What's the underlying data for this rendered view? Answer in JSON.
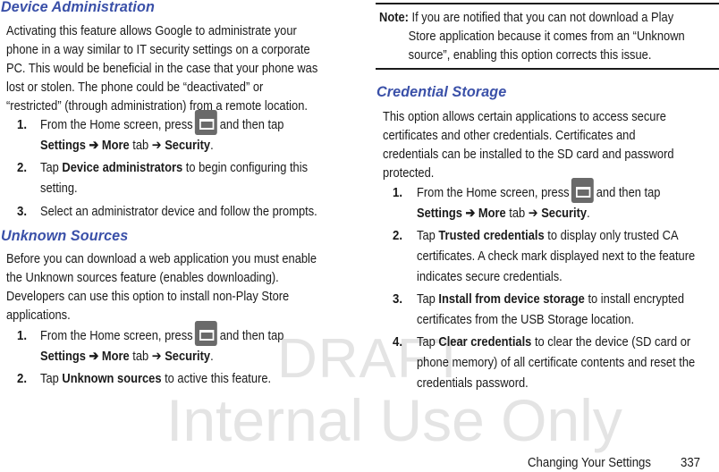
{
  "watermark": {
    "line1": "DRAFT",
    "line2": "Internal Use Only"
  },
  "left_column": {
    "device_admin": {
      "heading": "Device Administration",
      "paragraph_lines": [
        "Activating this feature allows Google to administrate your",
        "phone in a way similar to IT security settings on a corporate",
        "PC. This would be beneficial in the case that your phone was",
        "lost or stolen. The phone could be “deactivated” or",
        "“restricted” (through administration) from a remote location."
      ],
      "steps": [
        {
          "num": "1.",
          "pre": "From the Home screen, press",
          "icon": "menu-key-icon",
          "post": "and then tap",
          "line2_bold1": "Settings ➔ More",
          "line2_mid": " tab ➔ ",
          "line2_bold2": "Security",
          "line2_end": "."
        },
        {
          "num": "2.",
          "pre": "Tap ",
          "bold": "Device administrators",
          "post": " to begin configuring this",
          "line2": "setting."
        },
        {
          "num": "3.",
          "text": "Select an administrator device and follow the prompts."
        }
      ]
    },
    "unknown_sources": {
      "heading": "Unknown Sources",
      "paragraph_lines": [
        "Before you can download a web application you must enable",
        "the Unknown sources feature (enables downloading).",
        "Developers can use this option to install non-Play Store",
        "applications."
      ],
      "steps": [
        {
          "num": "1.",
          "pre": "From the Home screen, press",
          "icon": "menu-key-icon",
          "post": "and then tap",
          "line2_bold1": "Settings ➔ More",
          "line2_mid": " tab ➔ ",
          "line2_bold2": "Security",
          "line2_end": "."
        },
        {
          "num": "2.",
          "pre": "Tap ",
          "bold": "Unknown sources",
          "post": " to active this feature."
        }
      ]
    }
  },
  "right_column": {
    "note": {
      "label": "Note:",
      "lines": [
        " If you are notified that you can not download a Play",
        "Store application because it comes from an “Unknown",
        "source”, enabling this option corrects this issue."
      ]
    },
    "credential_storage": {
      "heading": "Credential Storage",
      "paragraph_lines": [
        "This option allows certain applications to access secure",
        "certificates and other credentials. Certificates and",
        "credentials can be installed to the SD card and password",
        "protected."
      ],
      "steps": [
        {
          "num": "1.",
          "pre": "From the Home screen, press",
          "icon": "menu-key-icon",
          "post": "and then tap",
          "line2_bold1": "Settings ➔ More",
          "line2_mid": " tab ➔ ",
          "line2_bold2": "Security",
          "line2_end": "."
        },
        {
          "num": "2.",
          "pre": "Tap ",
          "bold": "Trusted credentials",
          "post": " to display only trusted CA",
          "line2": "certificates. A check mark displayed next to the feature",
          "line3": "indicates secure credentials."
        },
        {
          "num": "3.",
          "pre": "Tap ",
          "bold": "Install from device storage",
          "post": " to install encrypted",
          "line2": "certificates from the USB Storage location."
        },
        {
          "num": "4.",
          "pre": "Tap ",
          "bold": "Clear credentials",
          "post": " to clear the device (SD card or",
          "line2": "phone memory) of all certificate contents and reset the",
          "line3": "credentials password."
        }
      ]
    }
  },
  "footer": {
    "section": "Changing Your Settings",
    "page": "337"
  },
  "colors": {
    "heading": "#3a50a8",
    "text": "#1a1a1a",
    "icon_bg": "#6a6a6a",
    "watermark": "#e4e4e4"
  }
}
